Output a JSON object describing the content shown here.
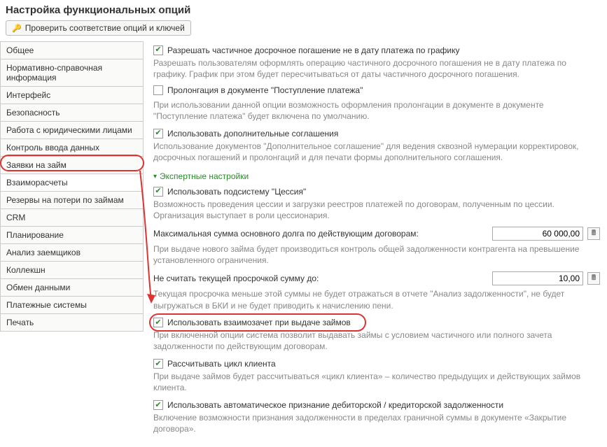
{
  "title": "Настройка функциональных опций",
  "toolbar": {
    "check_btn": "Проверить соответствие опций и ключей"
  },
  "sidebar": {
    "items": [
      {
        "label": "Общее"
      },
      {
        "label": "Нормативно-справочная информация"
      },
      {
        "label": "Интерфейс"
      },
      {
        "label": "Безопасность"
      },
      {
        "label": "Работа с юридическими лицами"
      },
      {
        "label": "Контроль ввода данных"
      },
      {
        "label": "Заявки на займ"
      },
      {
        "label": "Взаиморасчеты"
      },
      {
        "label": "Резервы на потери по займам"
      },
      {
        "label": "CRM"
      },
      {
        "label": "Планирование"
      },
      {
        "label": "Анализ заемщиков"
      },
      {
        "label": "Коллекшн"
      },
      {
        "label": "Обмен данными"
      },
      {
        "label": "Платежные системы"
      },
      {
        "label": "Печать"
      }
    ],
    "active_index": 7
  },
  "options": {
    "partial_early": {
      "label": "Разрешать частичное досрочное погашение не в дату платежа по графику",
      "checked": true,
      "hint": "Разрешать пользователям оформлять операцию частичного досрочного погашения не в дату платежа по графику. График при этом будет пересчитываться от даты частичного досрочного погашения."
    },
    "prolongation": {
      "label": "Пролонгация в документе \"Поступление платежа\"",
      "checked": false,
      "hint": "При использовании данной опции возможность оформления пролонгации в документе в документе \"Поступление платежа\" будет включена по умолчанию."
    },
    "extra_agreements": {
      "label": "Использовать дополнительные соглашения",
      "checked": true,
      "hint": "Использование документов \"Дополнительное соглашение\" для ведения сквозной нумерации корректировок, досрочных погашений и пролонгаций и для печати формы дополнительного соглашения."
    },
    "expert_toggle": "Экспертные настройки",
    "cession": {
      "label": "Использовать подсистему \"Цессия\"",
      "checked": true,
      "hint": "Возможность проведения цессии и загрузки реестров платежей по договорам, полученным по цессии. Организация выступает в роли цессионария."
    },
    "max_sum": {
      "label": "Максимальная сумма основного долга по действующим договорам:",
      "value": "60 000,00",
      "hint": "При выдаче нового займа будет производиться контроль общей задолженности контрагента на превышение установленного ограничения."
    },
    "ignore_overdue": {
      "label": "Не считать текущей просрочкой сумму до:",
      "value": "10,00",
      "hint": "Текущая просрочка меньше этой суммы не будет отражаться в отчете \"Анализ задолженности\", не будет выгружаться в БКИ и не будет приводить к начислению пени."
    },
    "offset": {
      "label": "Использовать взаимозачет при выдаче займов",
      "checked": true,
      "hint": "При включенной опции система позволит выдавать займы с условием частичного или полного зачета задолженности по действующим договорам."
    },
    "client_cycle": {
      "label": "Рассчитывать цикл клиента",
      "checked": true,
      "hint": "При выдаче займов будет рассчитываться «цикл клиента» – количество предыдущих и действующих займов клиента."
    },
    "auto_recognition": {
      "label": "Использовать автоматическое признание дебиторской / кредиторской задолженности",
      "checked": true,
      "hint": "Включение возможности признания задолженности в пределах граничной суммы в документе «Закрытие договора»."
    }
  }
}
